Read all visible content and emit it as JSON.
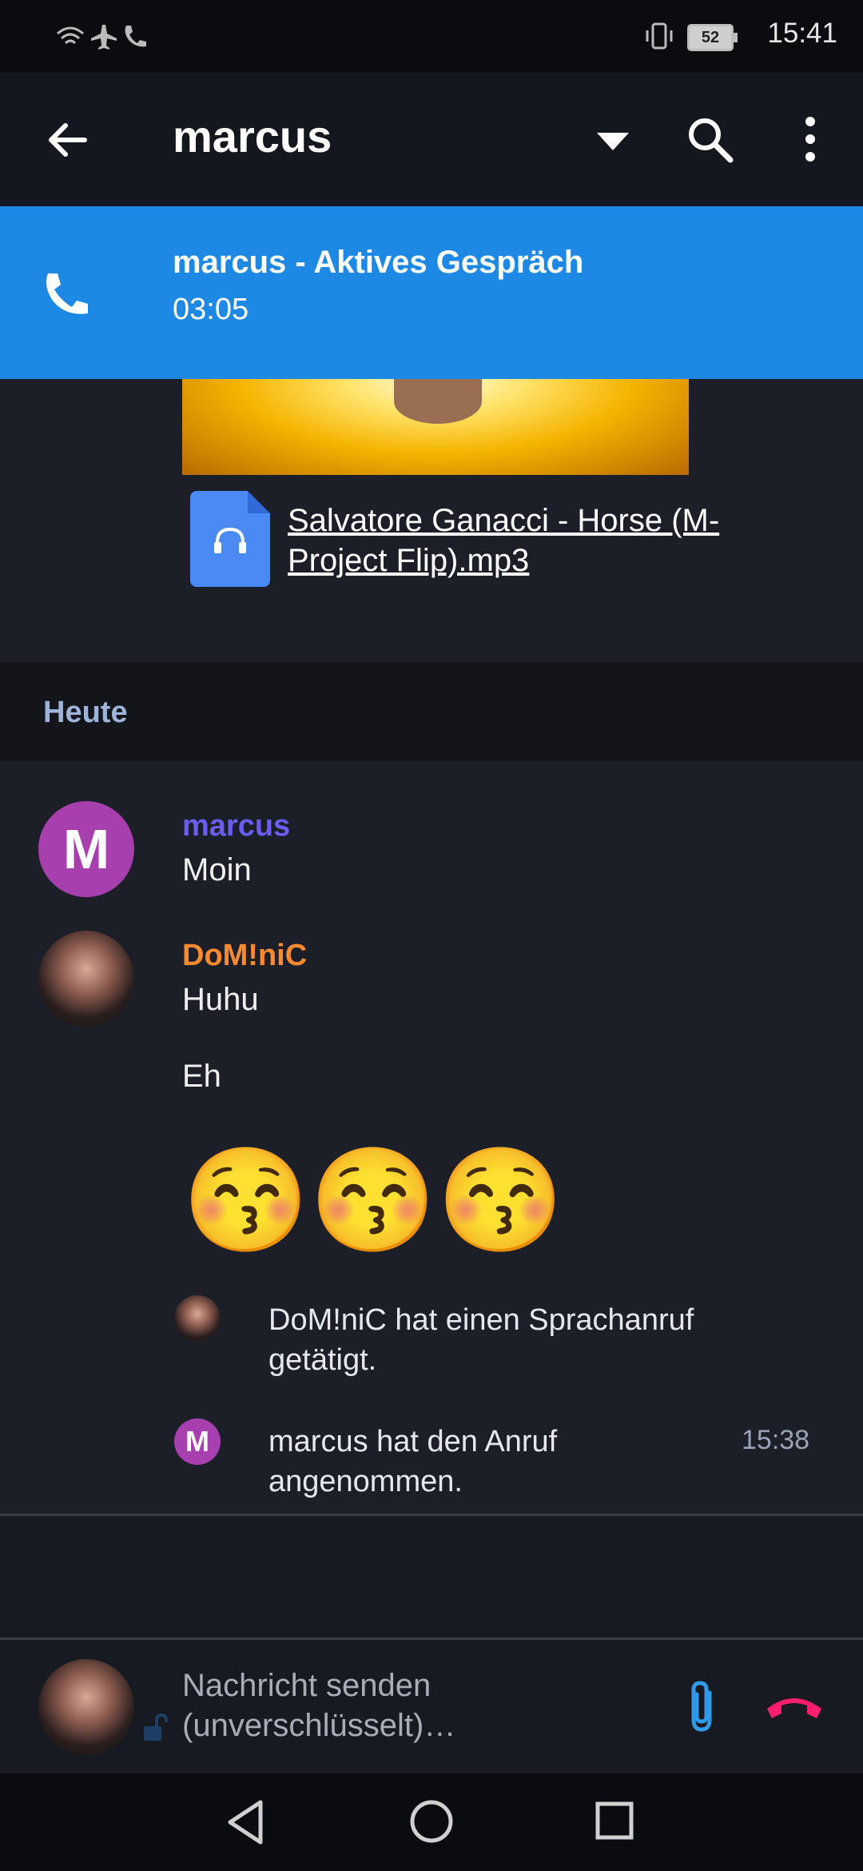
{
  "status_bar": {
    "time": "15:41",
    "battery": "52"
  },
  "toolbar": {
    "title": "marcus",
    "icons": [
      "back-arrow-icon",
      "dropdown-icon",
      "search-icon",
      "more-vert-icon"
    ]
  },
  "call_banner": {
    "title": "marcus - Aktives Gespräch",
    "duration": "03:05",
    "color": "#1e88e5"
  },
  "attachment": {
    "file_name": "Salvatore Ganacci - Horse (M-Project Flip).mp3"
  },
  "date_header": "Heute",
  "messages": [
    {
      "avatar_letter": "M",
      "sender": "marcus",
      "sender_color": "#6a5df0",
      "text": "Moin"
    },
    {
      "sender": "DoM!niC",
      "sender_color": "#ff8a30",
      "texts": [
        "Huhu",
        "Eh"
      ],
      "emoji": "😚😚😚"
    }
  ],
  "events": [
    {
      "text": "DoM!niC hat einen Sprachanruf getätigt."
    },
    {
      "avatar_letter": "M",
      "text": "marcus hat den Anruf angenommen.",
      "time": "15:38"
    }
  ],
  "composer": {
    "placeholder": "Nachricht senden (unverschlüsselt)…"
  }
}
